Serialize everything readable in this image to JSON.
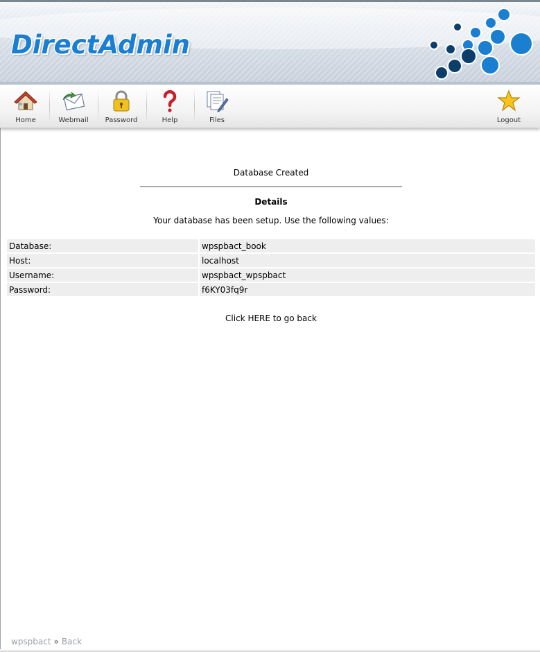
{
  "header": {
    "logo_text": "DirectAdmin"
  },
  "toolbar": {
    "items": [
      {
        "label": "Home",
        "icon": "home-icon"
      },
      {
        "label": "Webmail",
        "icon": "webmail-icon"
      },
      {
        "label": "Password",
        "icon": "padlock-icon"
      },
      {
        "label": "Help",
        "icon": "question-mark-icon"
      },
      {
        "label": "Files",
        "icon": "files-icon"
      }
    ],
    "logout": {
      "label": "Logout",
      "icon": "star-icon"
    }
  },
  "main": {
    "title": "Database Created",
    "details_heading": "Details",
    "intro": "Your database has been setup. Use the following values:",
    "rows": [
      {
        "key": "Database:",
        "value": "wpspbact_book"
      },
      {
        "key": "Host:",
        "value": "localhost"
      },
      {
        "key": "Username:",
        "value": "wpspbact_wpspbact"
      },
      {
        "key": "Password:",
        "value": "f6KY03fq9r"
      }
    ],
    "back": {
      "prefix": "Click ",
      "link": "HERE",
      "suffix": " to go back"
    }
  },
  "footer": {
    "user": "wpspbact",
    "separator": "»",
    "back": "Back"
  },
  "colors": {
    "brand_blue": "#1a7fd1",
    "dark_blue": "#0b3e6b",
    "row_bg": "#eeeeee"
  }
}
